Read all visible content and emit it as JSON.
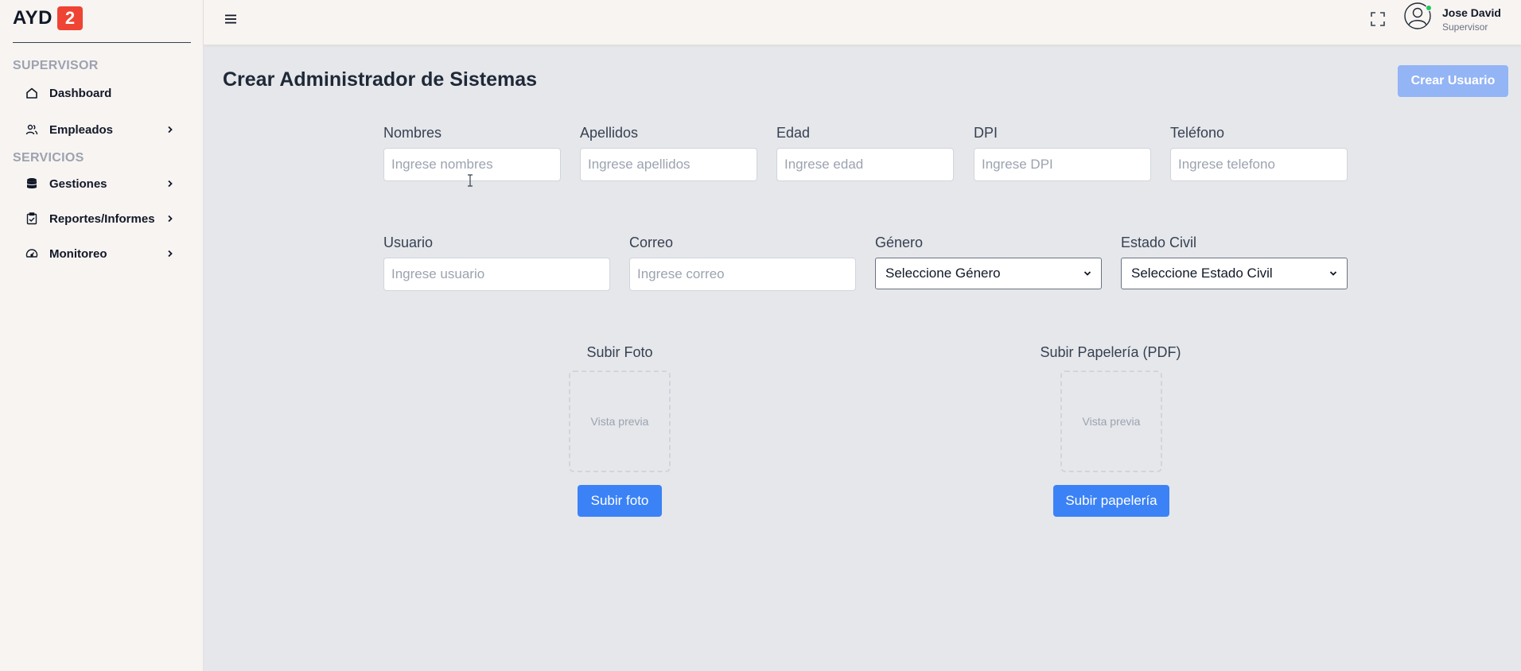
{
  "brand": {
    "text": "AYD",
    "badge": "2"
  },
  "sidebar": {
    "sections": [
      {
        "title": "SUPERVISOR"
      },
      {
        "title": "SERVICIOS"
      }
    ],
    "items": [
      {
        "label": "Dashboard",
        "icon": "home-icon",
        "has_chevron": false
      },
      {
        "label": "Empleados",
        "icon": "users-icon",
        "has_chevron": true
      },
      {
        "label": "Gestiones",
        "icon": "database-icon",
        "has_chevron": true
      },
      {
        "label": "Reportes/Informes",
        "icon": "clipboard-check-icon",
        "has_chevron": true
      },
      {
        "label": "Monitoreo",
        "icon": "gauge-icon",
        "has_chevron": true
      }
    ]
  },
  "topbar": {
    "user_name": "Jose David",
    "user_role": "Supervisor",
    "online_color": "#22c55e"
  },
  "main": {
    "title": "Crear Administrador de Sistemas",
    "create_button": "Crear Usuario",
    "fields_row1": [
      {
        "label": "Nombres",
        "placeholder": "Ingrese nombres"
      },
      {
        "label": "Apellidos",
        "placeholder": "Ingrese apellidos"
      },
      {
        "label": "Edad",
        "placeholder": "Ingrese edad"
      },
      {
        "label": "DPI",
        "placeholder": "Ingrese DPI"
      },
      {
        "label": "Teléfono",
        "placeholder": "Ingrese telefono"
      }
    ],
    "fields_row2": [
      {
        "label": "Usuario",
        "placeholder": "Ingrese usuario"
      },
      {
        "label": "Correo",
        "placeholder": "Ingrese correo"
      }
    ],
    "selects": [
      {
        "label": "Género",
        "value": "Seleccione Género"
      },
      {
        "label": "Estado Civil",
        "value": "Seleccione Estado Civil"
      }
    ],
    "uploads": [
      {
        "title": "Subir Foto",
        "preview": "Vista previa",
        "button": "Subir foto"
      },
      {
        "title": "Subir Papelería (PDF)",
        "preview": "Vista previa",
        "button": "Subir papelería"
      }
    ]
  },
  "colors": {
    "primary": "#3b82f6",
    "primary_disabled": "#93b4f5",
    "brand_badge": "#ef4433",
    "sidebar_bg": "#f8f4f2",
    "content_bg": "#e5e7eb"
  }
}
